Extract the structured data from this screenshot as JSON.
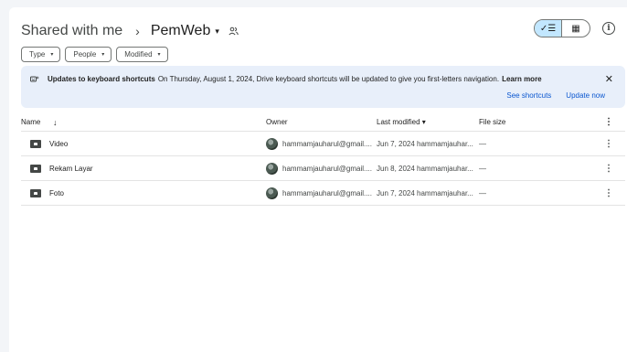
{
  "breadcrumb": {
    "root": "Shared with me",
    "separator": "›",
    "folder": "PemWeb",
    "folder_caret": "▾"
  },
  "view_toggle": {
    "list_icon": "✓☰",
    "grid_icon": "▦"
  },
  "info_icon": "i",
  "filters": [
    {
      "label": "Type",
      "caret": "▾"
    },
    {
      "label": "People",
      "caret": "▾"
    },
    {
      "label": "Modified",
      "caret": "▾"
    }
  ],
  "banner": {
    "icon": "keyboard-icon",
    "title": "Updates to keyboard shortcuts",
    "message": "On Thursday, August 1, 2024, Drive keyboard shortcuts will be updated to give you first-letters navigation.",
    "link": "Learn more",
    "close": "✕",
    "actions": {
      "see_shortcuts": "See shortcuts",
      "update_now": "Update now"
    }
  },
  "table": {
    "headers": {
      "name": "Name",
      "sort_arrow": "↓",
      "owner": "Owner",
      "last_modified": "Last modified ▾",
      "file_size": "File size",
      "more": "⋮"
    },
    "rows": [
      {
        "name": "Video",
        "owner": "hammamjauharul@gmail....",
        "modified": "Jun 7, 2024 hammamjauhar...",
        "size": "—",
        "more": "⋮"
      },
      {
        "name": "Rekam Layar",
        "owner": "hammamjauharul@gmail....",
        "modified": "Jun 8, 2024 hammamjauhar...",
        "size": "—",
        "more": "⋮"
      },
      {
        "name": "Foto",
        "owner": "hammamjauharul@gmail....",
        "modified": "Jun 7, 2024 hammamjauhar...",
        "size": "—",
        "more": "⋮"
      }
    ]
  },
  "colors": {
    "accent": "#0b57d0",
    "banner_bg": "#e8effa",
    "toggle_active": "#c2e7ff"
  }
}
